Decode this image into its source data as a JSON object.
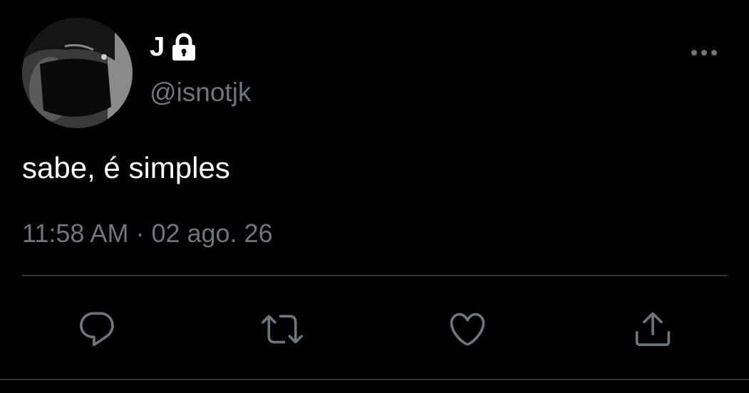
{
  "user": {
    "display_name": "J",
    "handle": "@isnotjk",
    "protected_icon": "lock-icon",
    "avatar": "profile-photo"
  },
  "tweet": {
    "text": "sabe, é simples",
    "time": "11:58 AM",
    "separator": "·",
    "date": "02 ago. 26"
  },
  "actions": {
    "reply": "reply-icon",
    "retweet": "retweet-icon",
    "like": "heart-icon",
    "share": "share-icon"
  },
  "colors": {
    "background": "#000000",
    "primary_text": "#ffffff",
    "secondary_text": "#6e767d",
    "divider": "#2f3336"
  }
}
